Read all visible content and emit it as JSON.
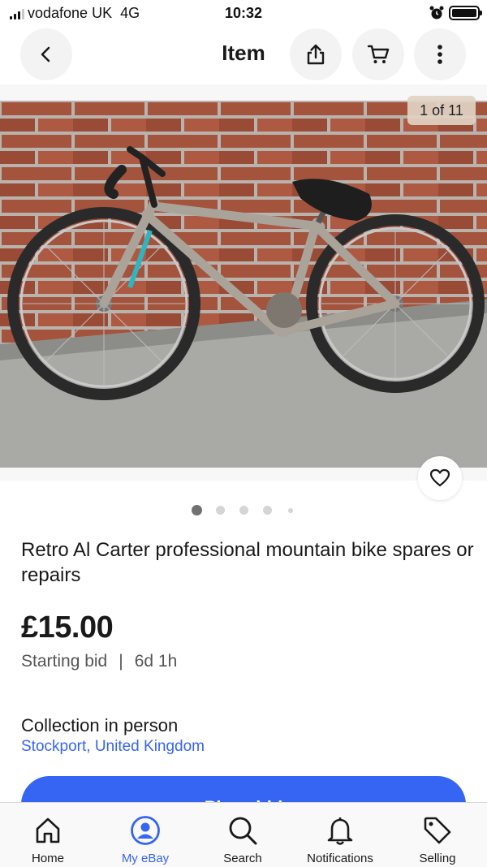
{
  "status_bar": {
    "carrier": "vodafone UK",
    "network": "4G",
    "time": "10:32",
    "icons": [
      "signal-icon",
      "alarm-icon",
      "battery-icon"
    ]
  },
  "header": {
    "title": "Item",
    "icons": [
      "chevron-left-icon",
      "share-icon",
      "cart-icon",
      "more-vertical-icon"
    ]
  },
  "gallery": {
    "counter": "1 of 11",
    "current_image": 1,
    "total_images": 11,
    "watch_icon": "heart-icon"
  },
  "item": {
    "title": "Retro Al Carter professional mountain bike spares or repairs",
    "price": "£15.00",
    "bid_type": "Starting bid",
    "separator": "|",
    "time_left": "6d 1h",
    "delivery": "Collection in person",
    "location": "Stockport, United Kingdom"
  },
  "actions": {
    "primary": "Place bid"
  },
  "bottom_nav": {
    "items": [
      {
        "label": "Home",
        "icon": "home-icon"
      },
      {
        "label": "My eBay",
        "icon": "user-icon",
        "active": true
      },
      {
        "label": "Search",
        "icon": "search-icon"
      },
      {
        "label": "Notifications",
        "icon": "bell-icon"
      },
      {
        "label": "Selling",
        "icon": "tag-icon"
      }
    ]
  },
  "colors": {
    "accent": "#3665f3",
    "text": "#191919",
    "secondary_text": "#555555"
  }
}
